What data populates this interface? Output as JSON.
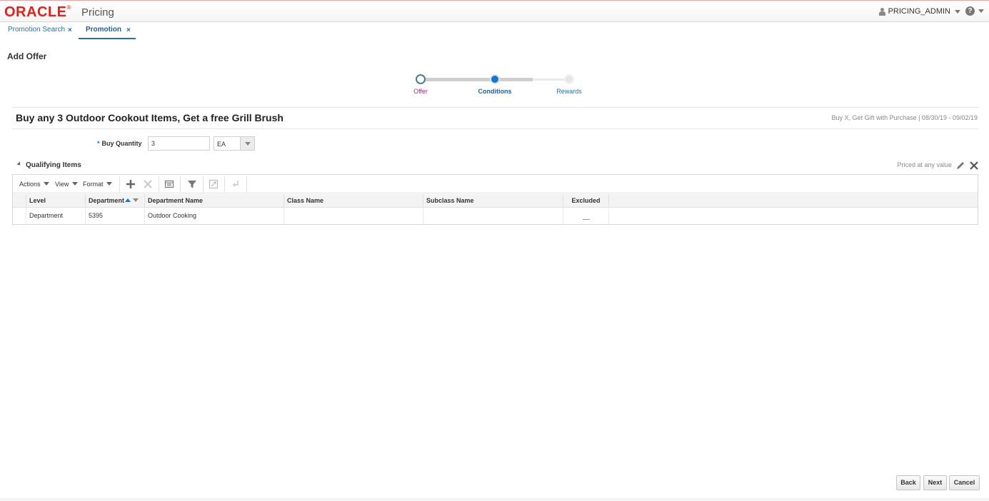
{
  "header": {
    "logo_text": "ORACLE",
    "logo_reg": "®",
    "app_name": "Pricing",
    "user_name": "PRICING_ADMIN",
    "help_glyph": "?"
  },
  "tabs": [
    {
      "label": "Promotion Search",
      "close": "×",
      "active": false
    },
    {
      "label": "Promotion",
      "close": "×",
      "active": true
    }
  ],
  "page_title": "Add Offer",
  "train": {
    "stops": [
      {
        "label": "Offer",
        "state": "visited"
      },
      {
        "label": "Conditions",
        "state": "current"
      },
      {
        "label": "Rewards",
        "state": "unvisited"
      }
    ]
  },
  "offer": {
    "title": "Buy any 3 Outdoor Cookout Items, Get a free Grill Brush",
    "meta": "Buy X, Get Gift with Purchase | 08/30/19 - 09/02/19"
  },
  "buy_quantity": {
    "required_mark": "*",
    "label": "Buy Quantity",
    "value": "3",
    "uom": "EA"
  },
  "qualifying_items": {
    "title": "Qualifying Items",
    "priced_text": "Priced at any value",
    "toolbar": {
      "actions": "Actions",
      "view": "View",
      "format": "Format",
      "icons": [
        "add-icon",
        "delete-icon",
        "detach-icon",
        "filter-icon",
        "freeze-icon",
        "wrap-icon"
      ]
    },
    "columns": [
      "Level",
      "Department",
      "Department Name",
      "Class Name",
      "Subclass Name",
      "Excluded"
    ],
    "rows": [
      {
        "level": "Department",
        "department": "5395",
        "department_name": "Outdoor Cooking",
        "class_name": "",
        "subclass_name": "",
        "excluded": ""
      }
    ]
  },
  "footer": {
    "back": "Back",
    "next": "Next",
    "cancel": "Cancel"
  },
  "colors": {
    "brand_red": "#e0201b",
    "link_blue": "#2a6ea7",
    "accent_blue": "#1a73c9"
  }
}
